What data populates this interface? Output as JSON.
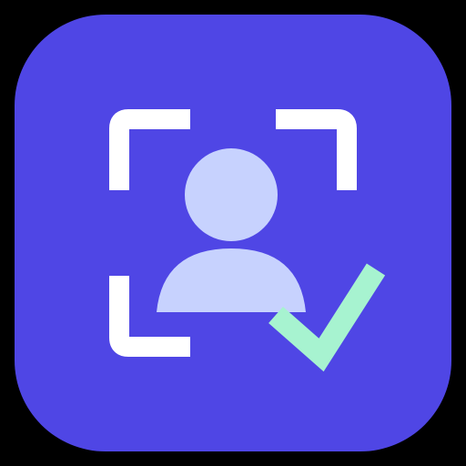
{
  "icon": {
    "name": "face-verification-app-icon",
    "icon_parts": [
      "scan-frame-icon",
      "person-icon",
      "checkmark-icon"
    ]
  },
  "colors": {
    "page_background": "#000000",
    "tile_background": "#4F46E5",
    "frame_corners": "#FFFFFF",
    "person": "#C7D2FE",
    "checkmark": "#A7F3D0"
  }
}
